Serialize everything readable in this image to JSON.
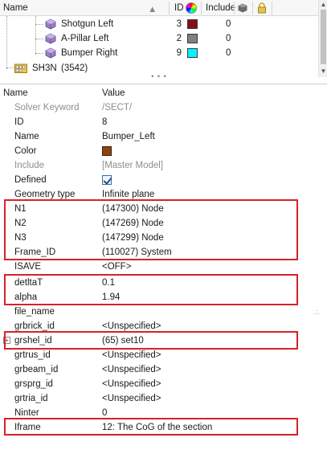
{
  "tree": {
    "headers": {
      "name": "Name",
      "id": "ID",
      "include": "Include"
    },
    "rows": [
      {
        "label": "Shotgun Left",
        "id": "3",
        "color": "#8b0a1a",
        "include": "0"
      },
      {
        "label": "A-Pillar Left",
        "id": "2",
        "color": "#808080",
        "include": "0"
      },
      {
        "label": "Bumper Right",
        "id": "9",
        "color": "#00f5ff",
        "include": "0"
      }
    ],
    "parent": {
      "label": "SH3N",
      "count": "(3542)"
    },
    "splitter": "• • •"
  },
  "properties": {
    "headers": {
      "name": "Name",
      "value": "Value"
    },
    "rows": [
      {
        "name": "Solver Keyword",
        "value": "/SECT/",
        "muted": true
      },
      {
        "name": "ID",
        "value": "8"
      },
      {
        "name": "Name",
        "value": "Bumper_Left"
      },
      {
        "name": "Color",
        "value": "",
        "swatch": "#8b4513"
      },
      {
        "name": "Include",
        "value": "[Master Model]",
        "muted": true
      },
      {
        "name": "Defined",
        "value": "",
        "checked": true
      },
      {
        "name": "Geometry type",
        "value": "Infinite plane"
      },
      {
        "name": "N1",
        "value": "(147300) Node"
      },
      {
        "name": "N2",
        "value": "(147269) Node"
      },
      {
        "name": "N3",
        "value": "(147299) Node"
      },
      {
        "name": "Frame_ID",
        "value": "(110027) System"
      },
      {
        "name": "ISAVE",
        "value": "<OFF>"
      },
      {
        "name": "detltaT",
        "value": "0.1"
      },
      {
        "name": "alpha",
        "value": "1.94"
      },
      {
        "name": "file_name",
        "value": ""
      },
      {
        "name": "grbrick_id",
        "value": "<Unspecified>"
      },
      {
        "name": "grshel_id",
        "value": "(65) set10"
      },
      {
        "name": "grtrus_id",
        "value": "<Unspecified>"
      },
      {
        "name": "grbeam_id",
        "value": "<Unspecified>"
      },
      {
        "name": "grsprg_id",
        "value": "<Unspecified>"
      },
      {
        "name": "grtria_id",
        "value": "<Unspecified>"
      },
      {
        "name": "Ninter",
        "value": "0"
      },
      {
        "name": "Iframe",
        "value": "12: The CoG of the section"
      }
    ]
  },
  "highlight_color": "#d9202b"
}
